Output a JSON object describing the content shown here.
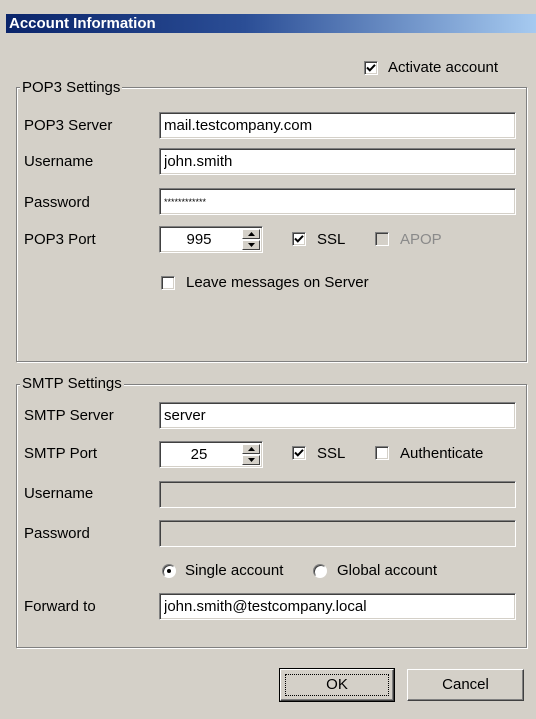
{
  "window": {
    "title": "Account Information"
  },
  "activate_account": {
    "label": "Activate account",
    "checked": true
  },
  "pop3": {
    "legend": "POP3 Settings",
    "server": {
      "label": "POP3 Server",
      "value": "mail.testcompany.com"
    },
    "username": {
      "label": "Username",
      "value": "john.smith"
    },
    "password": {
      "label": "Password",
      "value": "************"
    },
    "port": {
      "label": "POP3 Port",
      "value": "995"
    },
    "ssl": {
      "label": "SSL",
      "checked": true
    },
    "apop": {
      "label": "APOP",
      "checked": false,
      "enabled": false
    },
    "leave_messages": {
      "label": "Leave messages on Server",
      "checked": false
    }
  },
  "smtp": {
    "legend": "SMTP Settings",
    "server": {
      "label": "SMTP Server",
      "value": "server"
    },
    "port": {
      "label": "SMTP Port",
      "value": "25"
    },
    "ssl": {
      "label": "SSL",
      "checked": true
    },
    "authenticate": {
      "label": "Authenticate",
      "checked": false
    },
    "username": {
      "label": "Username",
      "value": ""
    },
    "password": {
      "label": "Password",
      "value": ""
    },
    "account_mode": {
      "options": [
        "Single account",
        "Global account"
      ],
      "selected": "Single account"
    },
    "forward_to": {
      "label": "Forward to",
      "value": "john.smith@testcompany.local"
    }
  },
  "buttons": {
    "ok": "OK",
    "cancel": "Cancel"
  },
  "colors": {
    "titlebar_start": "#0a246a",
    "titlebar_end": "#a6caf0",
    "dialog_bg": "#d4d0c8"
  }
}
